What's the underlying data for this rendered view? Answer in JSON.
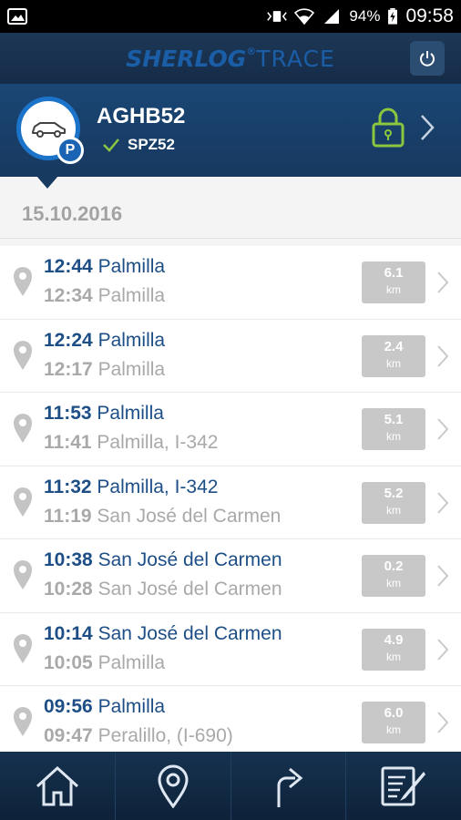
{
  "status_bar": {
    "battery": "94%",
    "time": "09:58",
    "icons": [
      "image-icon",
      "vibrate-icon",
      "wifi-icon",
      "signal-icon",
      "battery-icon"
    ]
  },
  "app_bar": {
    "brand_bold": "SHERLOG",
    "brand_reg": "®",
    "brand_thin": "TRACE",
    "power_icon": "power-icon"
  },
  "vehicle": {
    "name": "AGHB52",
    "plate": "SPZ52",
    "status_icon": "checkmark-icon",
    "badge": "P",
    "lock_icon": "padlock-icon"
  },
  "date": "15.10.2016",
  "trips": [
    {
      "end_time": "12:44",
      "end_place": "Palmilla",
      "start_time": "12:34",
      "start_place": "Palmilla",
      "km": "6.1",
      "unit": "km"
    },
    {
      "end_time": "12:24",
      "end_place": "Palmilla",
      "start_time": "12:17",
      "start_place": "Palmilla",
      "km": "2.4",
      "unit": "km"
    },
    {
      "end_time": "11:53",
      "end_place": "Palmilla",
      "start_time": "11:41",
      "start_place": "Palmilla, I-342",
      "km": "5.1",
      "unit": "km"
    },
    {
      "end_time": "11:32",
      "end_place": "Palmilla, I-342",
      "start_time": "11:19",
      "start_place": "San José del Carmen",
      "km": "5.2",
      "unit": "km"
    },
    {
      "end_time": "10:38",
      "end_place": "San José del Carmen",
      "start_time": "10:28",
      "start_place": "San José del Carmen",
      "km": "0.2",
      "unit": "km"
    },
    {
      "end_time": "10:14",
      "end_place": "San José del Carmen",
      "start_time": "10:05",
      "start_place": "Palmilla",
      "km": "4.9",
      "unit": "km"
    },
    {
      "end_time": "09:56",
      "end_place": "Palmilla",
      "start_time": "09:47",
      "start_place": "Peralillo, (I-690)",
      "km": "6.0",
      "unit": "km"
    }
  ],
  "bottom_nav": [
    {
      "name": "home",
      "icon": "home-icon"
    },
    {
      "name": "location",
      "icon": "location-pin-icon"
    },
    {
      "name": "route",
      "icon": "turn-right-arrow-icon"
    },
    {
      "name": "notes",
      "icon": "edit-notes-icon"
    }
  ],
  "colors": {
    "header_dark": "#152c48",
    "header_vehicle": "#1a4675",
    "brand_blue": "#1b5ea8",
    "text_blue": "#1d4e86",
    "text_gray": "#a9a9a9",
    "lock_green": "#8cc63f",
    "badge_gray": "#c8c8c8"
  }
}
